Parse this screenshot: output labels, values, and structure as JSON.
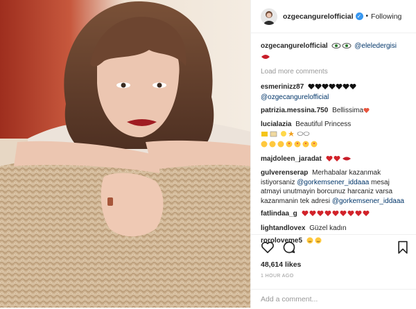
{
  "post": {
    "username": "ozgecangurelofficial",
    "follow_label": "Following",
    "separator": "•",
    "verified_mark": "✓"
  },
  "caption": {
    "user": "ozgecangurelofficial",
    "mention": "@eleledergisi"
  },
  "load_more": "Load more comments",
  "comments": [
    {
      "user": "esmerinizz87",
      "text": "",
      "mention": "@ozgecangurelofficial",
      "emoji": "black hearts"
    },
    {
      "user": "patrizia.messina.750",
      "text": "Bellissima",
      "emoji": "heart"
    },
    {
      "user": "lucialazia",
      "text": "Beautiful Princess",
      "emoji": "mixed emoji"
    },
    {
      "user": "majdoleen_jaradat",
      "text": "",
      "emoji": "hearts and lips"
    },
    {
      "user": "gulverenserap",
      "text": "Merhabalar kazanmak istiyorsaniz",
      "mention": "@gorkemsener_iddaaa",
      "text2": "mesaj atmayi unutmayin borcunuz harcaniz varsa kazanmanin tek adresi",
      "mention2": "@gorkemsener_iddaaa"
    },
    {
      "user": "fatlindaa_g",
      "text": "",
      "emoji": "hearts"
    },
    {
      "user": "lightandlovex",
      "text": "Güzel kadın"
    },
    {
      "user": "roroloveme5",
      "text": "",
      "emoji": "smiling faces"
    }
  ],
  "likes": "48,614 likes",
  "time_ago": "1 HOUR AGO",
  "add_comment_placeholder": "Add a comment...",
  "icons": [
    "heart-outline-icon",
    "comment-bubble-icon",
    "bookmark-icon"
  ],
  "colors": {
    "link": "#003569",
    "verified": "#3897f0",
    "heart": "#ed4956",
    "muted": "#999999"
  }
}
